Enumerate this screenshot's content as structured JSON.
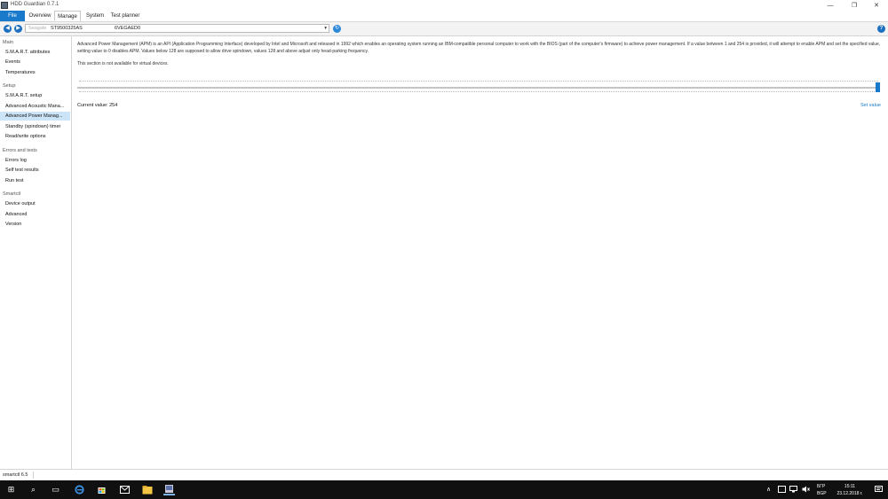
{
  "window": {
    "title": "HDD Guardian 0.7.1",
    "minimize_glyph": "—",
    "maximize_glyph": "❐",
    "close_glyph": "✕"
  },
  "menu": {
    "file": "File",
    "tabs": [
      "Overview",
      "Manage",
      "System",
      "Test planner"
    ]
  },
  "toolbar": {
    "drive_placeholder": "Seagate",
    "drive_model": "ST9500325AS",
    "drive_serial": "6VEGAED0",
    "dropdown_glyph": "▾",
    "back_glyph": "◀",
    "forward_glyph": "▶",
    "refresh_glyph": "↻",
    "help_glyph": "?"
  },
  "sidebar": {
    "groups": [
      {
        "title": "Main",
        "items": [
          {
            "label": "S.M.A.R.T. attributes"
          },
          {
            "label": "Events"
          },
          {
            "label": "Temperatures"
          }
        ]
      },
      {
        "title": "Setup",
        "items": [
          {
            "label": "S.M.A.R.T. setup"
          },
          {
            "label": "Advanced Acoustic Mana..."
          },
          {
            "label": "Advanced Power Manag..."
          },
          {
            "label": "Standby (spindown) timer"
          },
          {
            "label": "Read/write options"
          }
        ]
      },
      {
        "title": "Errors and tests",
        "items": [
          {
            "label": "Errors log"
          },
          {
            "label": "Self test results"
          },
          {
            "label": "Run test"
          }
        ]
      },
      {
        "title": "Smartctl",
        "items": [
          {
            "label": "Device output"
          },
          {
            "label": "Advanced"
          },
          {
            "label": "Version"
          }
        ]
      }
    ]
  },
  "main": {
    "description": "Advanced Power Management (APM) is an API (Application Programming Interface) developed by Intel and Microsoft and released in 1992 which enables an operating system running an IBM-compatible personal computer to work with the BIOS (part of the computer's firmware) to achieve power management. If a value between 1 and 254 is provided, it will attempt to enable APM and set the specified value, setting value to 0 disables APM. Values below 128 are supposed to allow drive spindown, values 128 and above adjust only head-parking frequency.",
    "note": "This section is not available for virtual devices.",
    "current_value_label": "Current value: 254",
    "set_value_label": "Set value",
    "slider": {
      "min": 0,
      "max": 254,
      "value": 254
    }
  },
  "statusbar": {
    "text": "smartctl 6.5"
  },
  "taskbar": {
    "start_glyph": "⊞",
    "search_glyph": "⌕",
    "taskview_glyph": "▭",
    "tray_up_glyph": "∧",
    "language_top": "БГР",
    "language_bottom": "BGP",
    "time": "15:11",
    "date": "23.12.2018 г."
  },
  "colors": {
    "accent": "#1979ca",
    "selected_bg": "#cce4f7",
    "taskbar_bg": "#101010"
  }
}
